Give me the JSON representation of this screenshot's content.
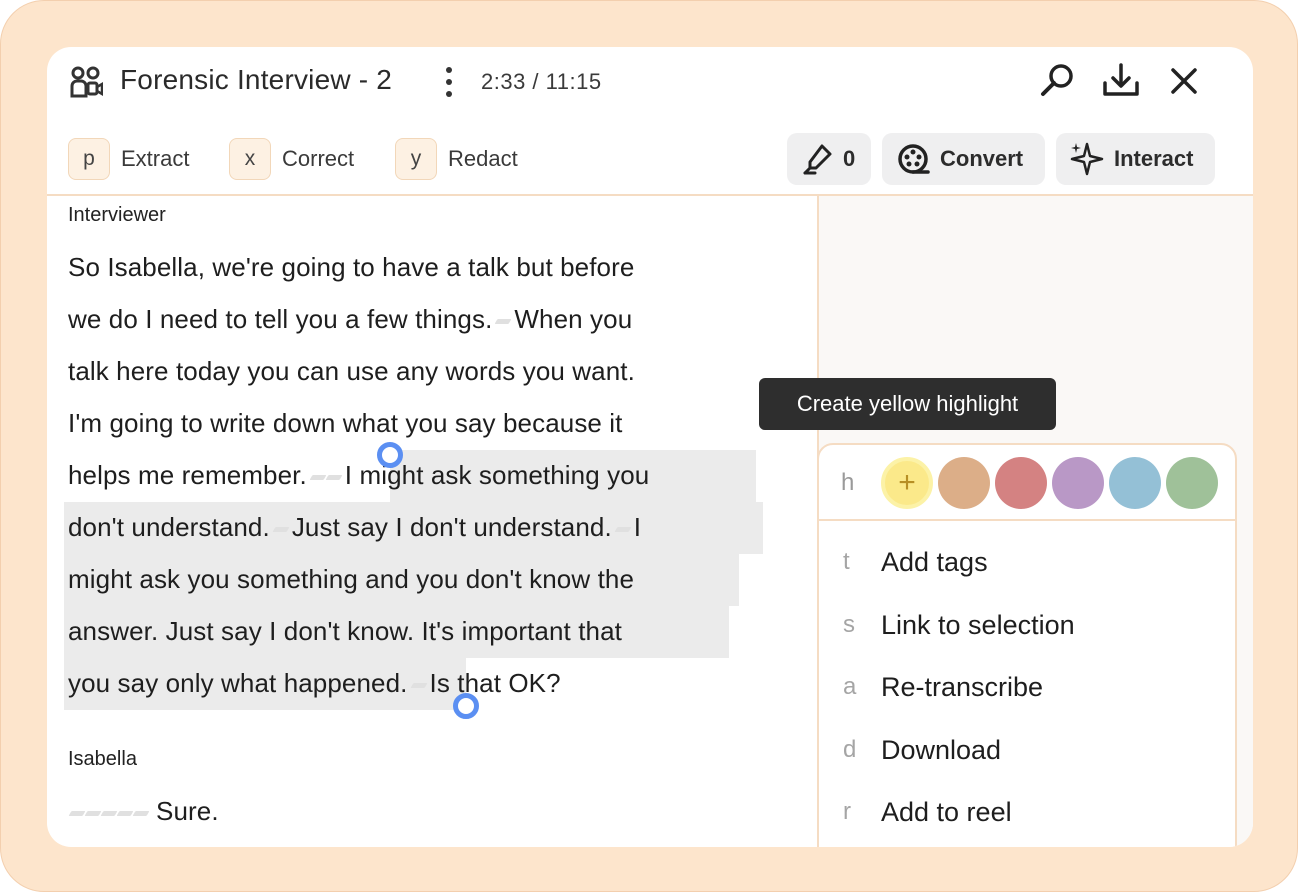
{
  "header": {
    "title": "Forensic Interview - 2",
    "time": "2:33 / 11:15"
  },
  "tools": [
    {
      "key": "p",
      "label": "Extract"
    },
    {
      "key": "x",
      "label": "Correct"
    },
    {
      "key": "y",
      "label": "Redact"
    }
  ],
  "actions": {
    "highlights_count": "0",
    "convert_label": "Convert",
    "interact_label": "Interact"
  },
  "transcript": {
    "speaker1": "Interviewer",
    "lines": [
      "So Isabella, we're going to have a talk but before",
      "we do I need to tell you a few things.",
      "When you",
      "talk here today you can use any words you want.",
      "I'm going to write down what you say because it",
      "helps me remember.",
      "I might ask something you",
      "don't understand.",
      "Just say I don't understand.",
      "I",
      "might ask you something and you don't know the",
      "answer. Just say I don't know. It's important that",
      "you say only what happened.",
      "Is that OK?"
    ],
    "speaker2": "Isabella",
    "reply": "Sure."
  },
  "tooltip": "Create yellow highlight",
  "menu": {
    "highlight_key": "h",
    "add_symbol": "+",
    "swatches": [
      "#fbe98a",
      "#dcae88",
      "#d48282",
      "#b998c6",
      "#94c0d6",
      "#9fc199"
    ],
    "items": [
      {
        "key": "t",
        "label": "Add tags"
      },
      {
        "key": "s",
        "label": "Link to selection"
      },
      {
        "key": "a",
        "label": "Re-transcribe"
      },
      {
        "key": "d",
        "label": "Download"
      },
      {
        "key": "r",
        "label": "Add to reel"
      }
    ]
  }
}
